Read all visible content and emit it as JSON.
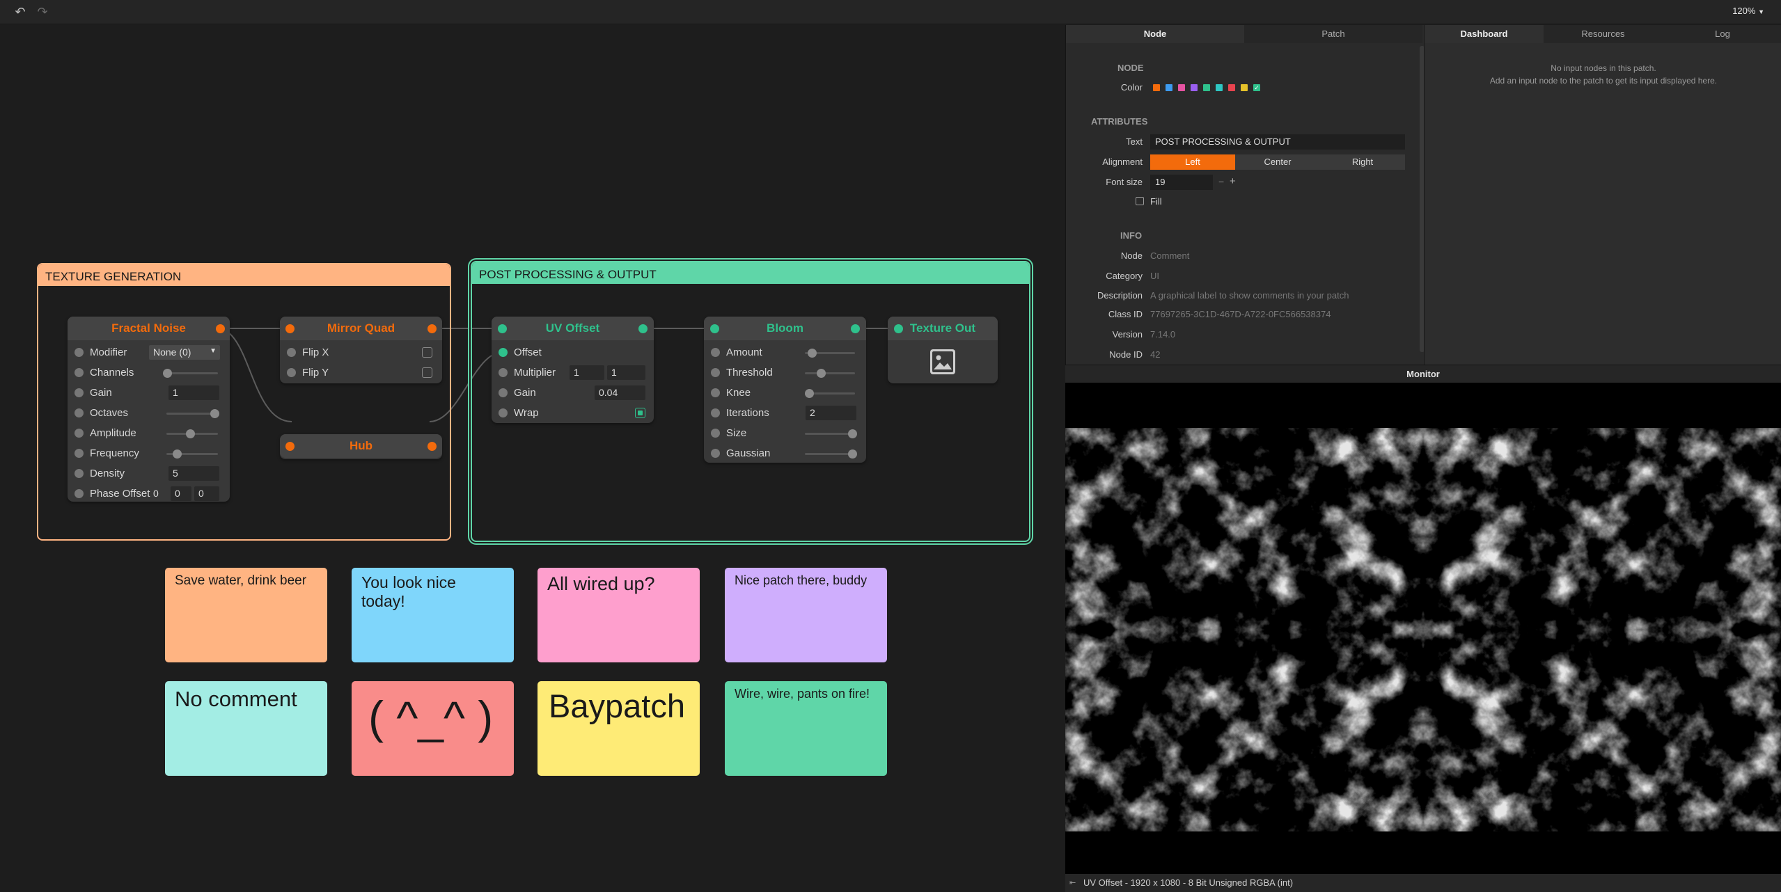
{
  "toolbar": {
    "undo_icon": "undo-icon",
    "redo_icon": "redo-icon",
    "zoom": "120%"
  },
  "groups": {
    "texture": {
      "title": "TEXTURE GENERATION",
      "color": "#ffb482"
    },
    "post": {
      "title": "POST PROCESSING & OUTPUT",
      "color": "#5fd6a8"
    }
  },
  "nodes": {
    "fractal": {
      "title": "Fractal Noise",
      "modifier_label": "Modifier",
      "modifier_value": "None (0)",
      "channels_label": "Channels",
      "gain_label": "Gain",
      "gain_value": "1",
      "octaves_label": "Octaves",
      "amplitude_label": "Amplitude",
      "frequency_label": "Frequency",
      "density_label": "Density",
      "density_value": "5",
      "phase_label": "Phase Offset",
      "phase_values": [
        "0",
        "0",
        "0"
      ]
    },
    "mirror": {
      "title": "Mirror Quad",
      "flipx_label": "Flip X",
      "flipy_label": "Flip Y"
    },
    "hub": {
      "title": "Hub"
    },
    "uv": {
      "title": "UV Offset",
      "offset_label": "Offset",
      "multiplier_label": "Multiplier",
      "multiplier_values": [
        "1",
        "1"
      ],
      "gain_label": "Gain",
      "gain_value": "0.04",
      "wrap_label": "Wrap"
    },
    "bloom": {
      "title": "Bloom",
      "amount_label": "Amount",
      "threshold_label": "Threshold",
      "knee_label": "Knee",
      "iterations_label": "Iterations",
      "iterations_value": "2",
      "size_label": "Size",
      "gaussian_label": "Gaussian"
    },
    "texout": {
      "title": "Texture Out",
      "icon": "image-icon"
    }
  },
  "notes": [
    {
      "text": "Save water, drink beer",
      "color": "#ffb482"
    },
    {
      "text": "You look nice today!",
      "color": "#7fd6fb"
    },
    {
      "text": "All wired up?",
      "color": "#fe9fcd"
    },
    {
      "text": "Nice patch there, buddy",
      "color": "#cfaefd"
    },
    {
      "text": "No comment",
      "color": "#a3ede4"
    },
    {
      "text": "( ^_^ )",
      "color": "#f98c8a"
    },
    {
      "text": "Baypatch",
      "color": "#feeb76"
    },
    {
      "text": "Wire, wire, pants on fire!",
      "color": "#5fd6a8"
    }
  ],
  "panel": {
    "tabs": [
      "Node",
      "Patch"
    ],
    "node_section": "NODE",
    "color_label": "Color",
    "swatches": [
      "#f36b0c",
      "#3d9bf0",
      "#e653a2",
      "#9a5ff0",
      "#2fc18c",
      "#2ec7c3",
      "#e8434e",
      "#e6c22a",
      "#2fc18c"
    ],
    "attributes_section": "ATTRIBUTES",
    "text_label": "Text",
    "text_value": "POST PROCESSING & OUTPUT",
    "alignment_label": "Alignment",
    "align_options": [
      "Left",
      "Center",
      "Right"
    ],
    "fontsize_label": "Font size",
    "fontsize_value": "19",
    "minus": "−",
    "plus": "+",
    "fill_label": "Fill",
    "info_section": "INFO",
    "info": [
      {
        "label": "Node",
        "value": "Comment"
      },
      {
        "label": "Category",
        "value": "UI"
      },
      {
        "label": "Description",
        "value": "A graphical label to show comments in your patch"
      },
      {
        "label": "Class ID",
        "value": "77697265-3C1D-467D-A722-0FC566538374"
      },
      {
        "label": "Version",
        "value": "7.14.0"
      },
      {
        "label": "Node ID",
        "value": "42"
      }
    ]
  },
  "dashboard": {
    "tabs": [
      "Dashboard",
      "Resources",
      "Log"
    ],
    "line1": "No input nodes in this patch.",
    "line2": "Add an input node to the patch to get its input displayed here."
  },
  "monitor": {
    "title": "Monitor",
    "status": "UV Offset - 1920 x 1080 - 8 Bit Unsigned RGBA (int)"
  }
}
